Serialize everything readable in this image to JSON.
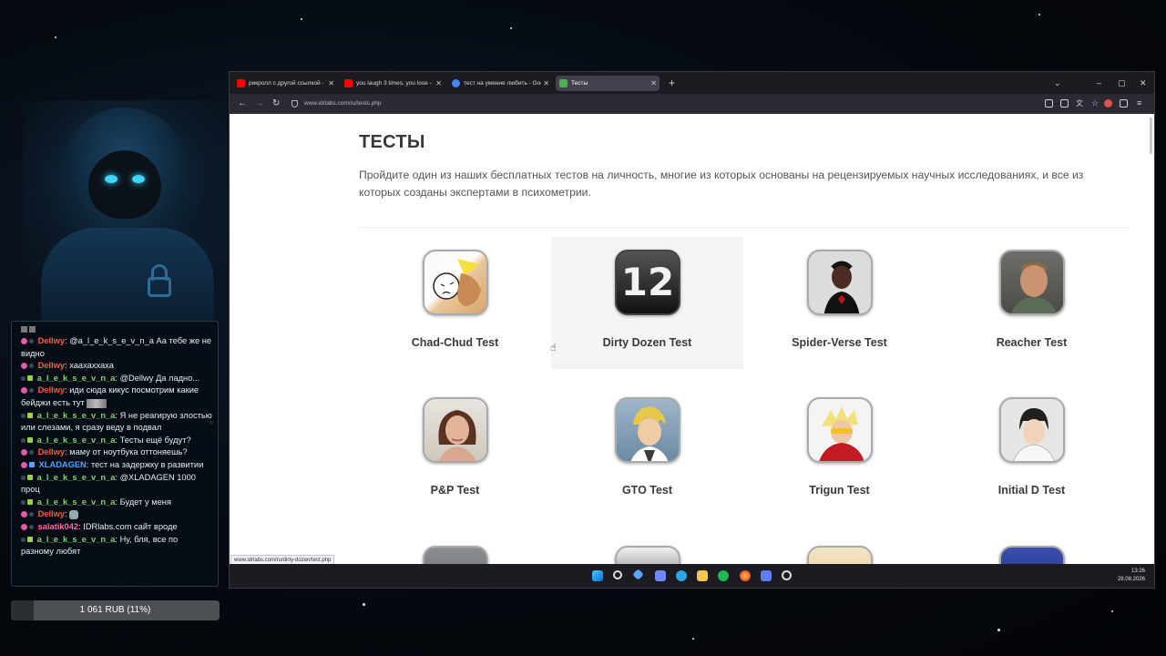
{
  "chat": {
    "messages": [
      {
        "user": "Dellwy",
        "color": "#ff5a3c",
        "text": "@a_l_e_k_s_e_v_n_a Аа тебе же не видно"
      },
      {
        "user": "Dellwy",
        "color": "#ff5a3c",
        "text": "хаахаххаха"
      },
      {
        "user": "a_l_e_k_s_e_v_n_a",
        "color": "#7dd36e",
        "text": "@Dellwy Да ладно..."
      },
      {
        "user": "Dellwy",
        "color": "#ff5a3c",
        "text": "иди сюда кикус посмотрим какие бейджи есть тут"
      },
      {
        "user": "a_l_e_k_s_e_v_n_a",
        "color": "#7dd36e",
        "text": "Я не реагирую злостью или слезами, я сразу веду в подвал"
      },
      {
        "user": "a_l_e_k_s_e_v_n_a",
        "color": "#7dd36e",
        "text": "Тесты ещё будут?"
      },
      {
        "user": "Dellwy",
        "color": "#ff5a3c",
        "text": "маму от ноутбука оттоняешь?"
      },
      {
        "user": "XLADAGEN",
        "color": "#4aa7ff",
        "text": "тест на задержку в развитии"
      },
      {
        "user": "a_l_e_k_s_e_v_n_a",
        "color": "#7dd36e",
        "text": "@XLADAGEN 1000 проц"
      },
      {
        "user": "a_l_e_k_s_e_v_n_a",
        "color": "#7dd36e",
        "text": "Будет у меня"
      },
      {
        "user": "Dellwy",
        "color": "#ff5a3c",
        "text": ""
      },
      {
        "user": "salatik042",
        "color": "#ff6aa8",
        "text": "IDRlabs.com сайт вроде"
      },
      {
        "user": "a_l_e_k_s_e_v_n_a",
        "color": "#7dd36e",
        "text": "Ну, бля, все по разному любят"
      }
    ]
  },
  "donation": {
    "text": "1 061 RUB (11%)",
    "progress": 0.11
  },
  "browser": {
    "tabs": [
      {
        "title": "рикролл с другой ссылкой - Yo",
        "favicon_color": "#ff0000"
      },
      {
        "title": "you laugh 3 times, you lose - Yo",
        "favicon_color": "#ff0000"
      },
      {
        "title": "тест на умение любить - Goog",
        "favicon_color": "#4285f4"
      },
      {
        "title": "Тесты",
        "favicon_color": "#4caf50"
      }
    ],
    "new_tab": "+",
    "url": "www.idrlabs.com/ru/tests.php",
    "status_link": "www.idrlabs.com/ru/dirty-dozen/test.php"
  },
  "page": {
    "title": "ТЕСТЫ",
    "intro": "Пройдите один из наших бесплатных тестов на личность, многие из которых основаны на рецензируемых научных исследованиях, и все из которых созданы экспертами в психометрии.",
    "tests": [
      {
        "label": "Chad-Chud Test"
      },
      {
        "label": "Dirty Dozen Test",
        "badge": "12"
      },
      {
        "label": "Spider-Verse Test"
      },
      {
        "label": "Reacher Test"
      },
      {
        "label": "P&P Test"
      },
      {
        "label": "GTO Test"
      },
      {
        "label": "Trigun Test"
      },
      {
        "label": "Initial D Test"
      }
    ]
  },
  "taskbar": {
    "time": "13:26",
    "date": "28.08.2026"
  }
}
